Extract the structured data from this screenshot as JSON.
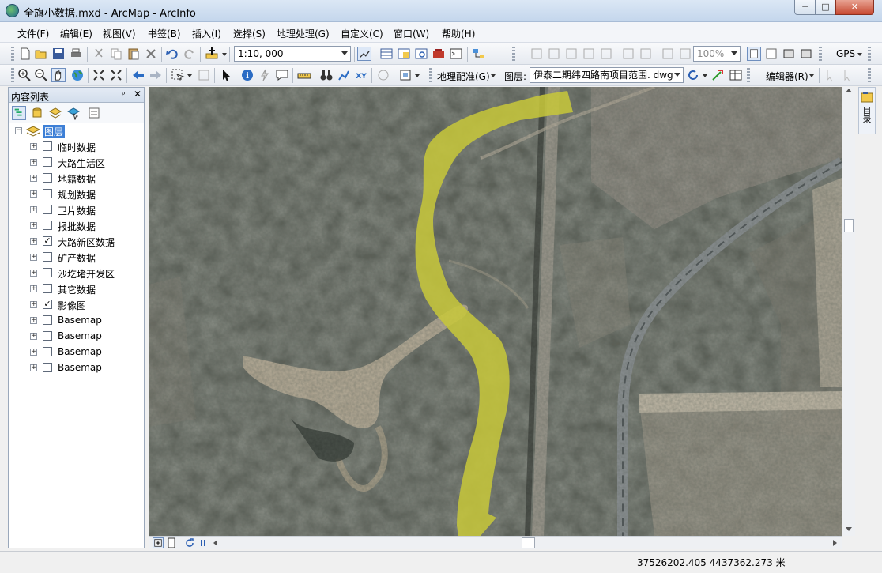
{
  "window": {
    "title": "全旗小数据.mxd - ArcMap - ArcInfo",
    "minimize": "─",
    "maximize": "□",
    "close": "✕"
  },
  "menu": [
    "文件(F)",
    "编辑(E)",
    "视图(V)",
    "书签(B)",
    "插入(I)",
    "选择(S)",
    "地理处理(G)",
    "自定义(C)",
    "窗口(W)",
    "帮助(H)"
  ],
  "toolbar1": {
    "scale": "1:10, 000",
    "zoom_percent": "100%",
    "gps": "GPS"
  },
  "toolbar2": {
    "georeferencing": "地理配准(G)",
    "layer_label": "图层:",
    "layer_value": "伊泰二期纬四路南项目范围. dwg",
    "editor": "编辑器(R)"
  },
  "toc": {
    "title": "内容列表",
    "pin": "ᵖ",
    "close": "✕",
    "root": "图层",
    "layers": [
      {
        "name": "临时数据",
        "checked": false
      },
      {
        "name": "大路生活区",
        "checked": false
      },
      {
        "name": "地籍数据",
        "checked": false
      },
      {
        "name": "规划数据",
        "checked": false
      },
      {
        "name": "卫片数据",
        "checked": false
      },
      {
        "name": "报批数据",
        "checked": false
      },
      {
        "name": "大路新区数据",
        "checked": true
      },
      {
        "name": "矿产数据",
        "checked": false
      },
      {
        "name": "沙圪堵开发区",
        "checked": false
      },
      {
        "name": "其它数据",
        "checked": false
      },
      {
        "name": "影像图",
        "checked": true
      },
      {
        "name": "Basemap",
        "checked": false
      },
      {
        "name": "Basemap",
        "checked": false
      },
      {
        "name": "Basemap",
        "checked": false
      },
      {
        "name": "Basemap",
        "checked": false
      }
    ]
  },
  "side_panel": {
    "label": "目录"
  },
  "status": {
    "coordinates": "37526202.405  4437362.273 米"
  },
  "colors": {
    "highlight_polygon": "#c8c83a",
    "selection_blue": "#3d7fd6"
  }
}
